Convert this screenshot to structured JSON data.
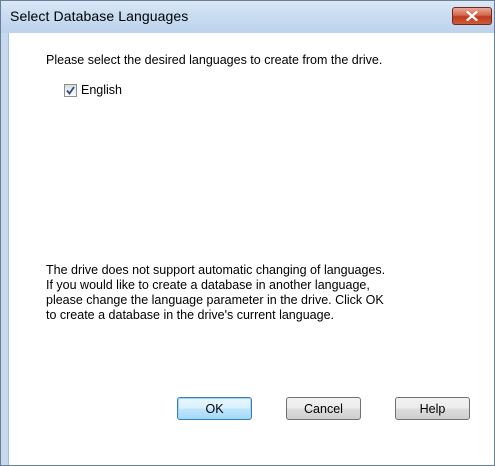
{
  "window": {
    "title": "Select Database Languages",
    "close_icon": "close-icon"
  },
  "prompt": "Please select the desired languages to create from the drive.",
  "languages": [
    {
      "label": "English",
      "checked": true
    }
  ],
  "note": {
    "lines": [
      "The drive does not support automatic changing of languages.",
      "If you would like to create a database in another language,",
      "please change the language parameter in the drive.  Click OK",
      "to create a database in the drive's current language."
    ]
  },
  "buttons": {
    "ok": "OK",
    "cancel": "Cancel",
    "help": "Help"
  },
  "colors": {
    "titlebar": "#c9dcf1",
    "close_button": "#c7432a",
    "default_button_border": "#3c7fb1"
  }
}
